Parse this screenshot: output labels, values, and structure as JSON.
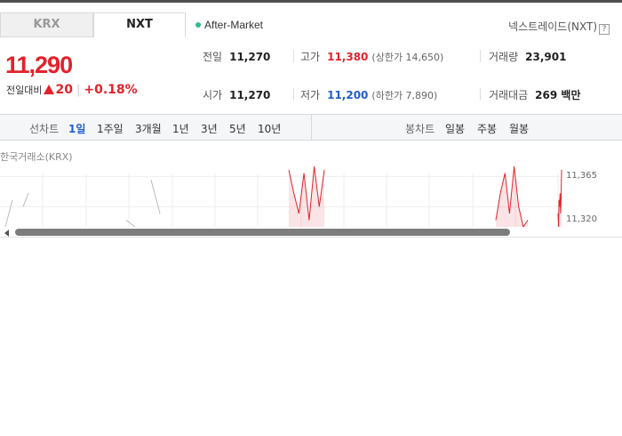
{
  "tabs": [
    {
      "label": "KRX",
      "active": false
    },
    {
      "label": "NXT",
      "active": true
    }
  ],
  "market_status": {
    "label": "After-Market",
    "dot_color": "#2dbd8a"
  },
  "provider": {
    "label": "넥스트레이드(NXT)",
    "help": "?"
  },
  "price": {
    "current": "11,290",
    "change_label": "전일대비",
    "change": "20",
    "rate": "+0.18%",
    "direction": "up",
    "up_color": "#e22229"
  },
  "stats": {
    "prev_close": {
      "label": "전일",
      "value": "11,270"
    },
    "open": {
      "label": "시가",
      "value": "11,270"
    },
    "high": {
      "label": "고가",
      "value": "11,380",
      "limit": "(상한가 14,650)"
    },
    "low": {
      "label": "저가",
      "value": "11,200",
      "limit": "(하한가 7,890)"
    },
    "volume": {
      "label": "거래량",
      "value": "23,901"
    },
    "amount": {
      "label": "거래대금",
      "value": "269 백만"
    }
  },
  "line_chart_bar": {
    "title": "선차트",
    "periods": [
      "1일",
      "1주일",
      "3개월",
      "1년",
      "3년",
      "5년",
      "10년"
    ],
    "active": "1일"
  },
  "candle_chart_bar": {
    "title": "봉차트",
    "periods": [
      "일봉",
      "주봉",
      "월봉"
    ]
  },
  "chart": {
    "source": "한국거래소(KRX)",
    "y_ticks": [
      "11,365",
      "11,320"
    ],
    "up_color": "#e22229",
    "krx_color": "#bbbbbb"
  },
  "chart_data": {
    "type": "line",
    "ylim": [
      11290,
      11380
    ],
    "yticks": [
      11365,
      11320
    ],
    "series": [
      {
        "values": [
          11290,
          11330,
          11320,
          11340,
          11300,
          11290,
          11360,
          11310,
          11290
        ]
      },
      {
        "values": [
          11375,
          11340,
          11310,
          11370,
          11300,
          11380,
          11320,
          11375,
          11300,
          11340,
          11370,
          11310,
          11380,
          11320,
          11290,
          11300,
          11310,
          11290,
          11330,
          11320,
          11340,
          11310,
          11330
        ]
      }
    ]
  }
}
